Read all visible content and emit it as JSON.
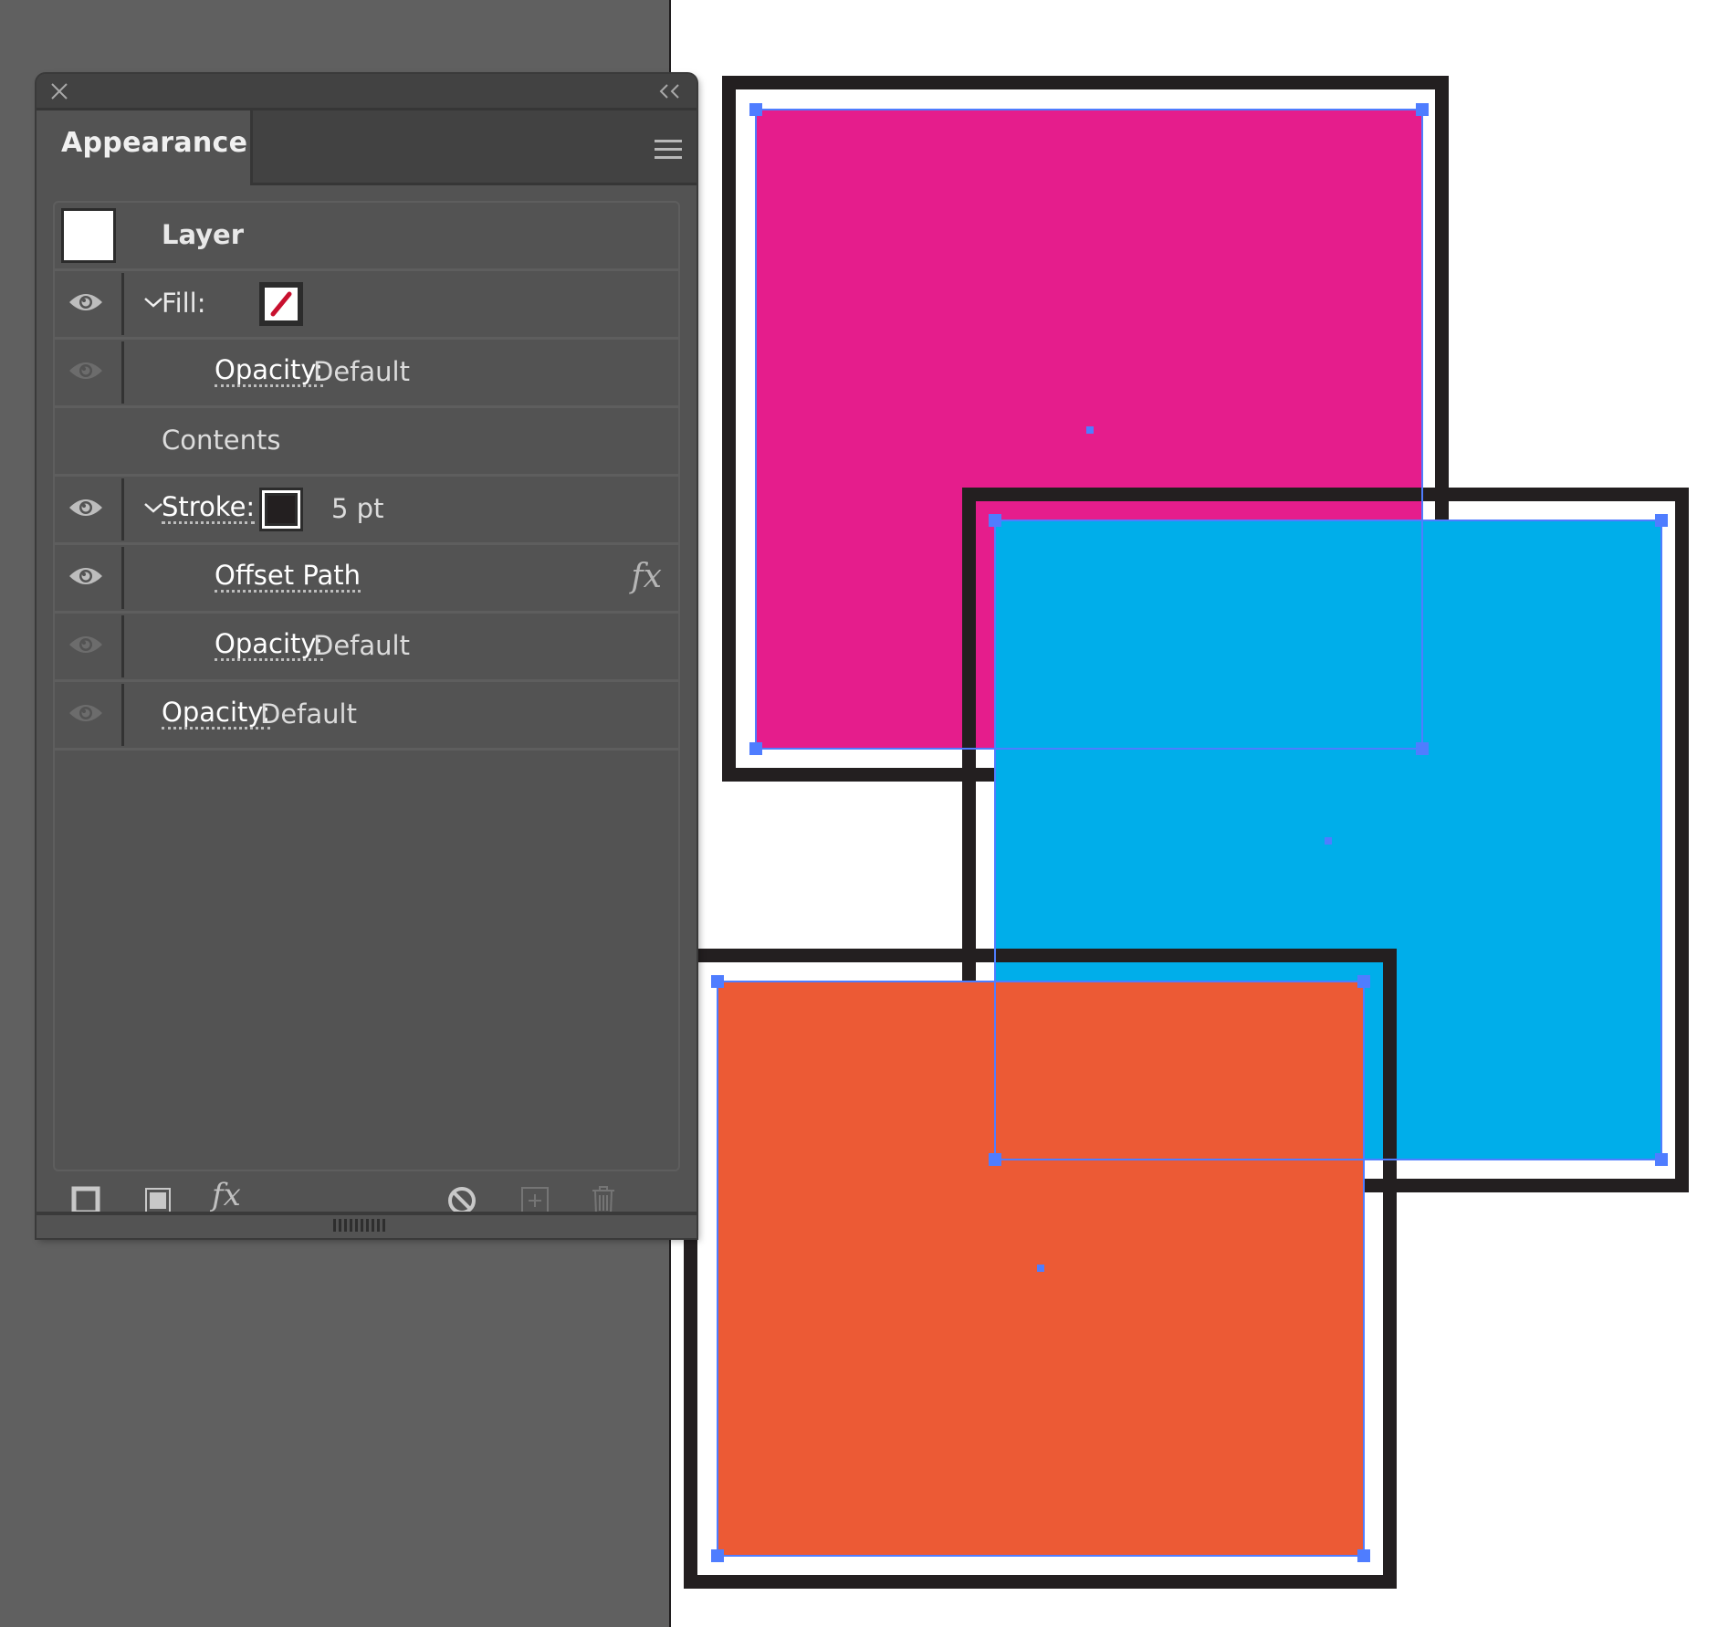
{
  "panel": {
    "title": "Appearance",
    "close_icon": "close-icon",
    "collapse_icon": "double-chevron-left-icon",
    "menu_icon": "hamburger-menu-icon",
    "rows": [
      {
        "type": "header",
        "label": "Layer",
        "thumbnail": "white-square"
      },
      {
        "type": "attribute",
        "label": "Fill:",
        "visible": true,
        "expanded": true,
        "swatch": "none",
        "value": ""
      },
      {
        "type": "sub",
        "label": "Opacity:",
        "value": "Default",
        "visible": false
      },
      {
        "type": "group",
        "label": "Contents"
      },
      {
        "type": "attribute",
        "label": "Stroke:",
        "visible": true,
        "expanded": true,
        "swatch": "#231f20",
        "value": "5 pt"
      },
      {
        "type": "effect",
        "label": "Offset Path",
        "visible": true,
        "fx_icon": "fx-icon"
      },
      {
        "type": "sub",
        "label": "Opacity:",
        "value": "Default",
        "visible": false
      },
      {
        "type": "top",
        "label": "Opacity:",
        "value": "Default",
        "visible": false
      }
    ],
    "footer": {
      "buttons": [
        {
          "name": "add-new-stroke",
          "icon": "stroke-square-icon",
          "enabled": true
        },
        {
          "name": "add-new-fill",
          "icon": "fill-square-icon",
          "enabled": true
        },
        {
          "name": "add-new-effect",
          "icon": "fx-icon",
          "label": "fx",
          "enabled": true
        },
        {
          "name": "clear-appearance",
          "icon": "no-symbol-icon",
          "enabled": true
        },
        {
          "name": "duplicate-item",
          "icon": "add-square-icon",
          "enabled": false
        },
        {
          "name": "delete-item",
          "icon": "trash-icon",
          "enabled": false
        }
      ]
    }
  },
  "artwork": {
    "colors": {
      "magenta": "#e51d8c",
      "cyan": "#00aeea",
      "orange": "#ec5a35",
      "stroke": "#231f20",
      "selection": "#4f7dff"
    },
    "shapes": [
      {
        "name": "magenta-rectangle",
        "fill": "#e51d8c"
      },
      {
        "name": "cyan-rectangle",
        "fill": "#00aeea"
      },
      {
        "name": "orange-rectangle",
        "fill": "#ec5a35"
      }
    ]
  }
}
